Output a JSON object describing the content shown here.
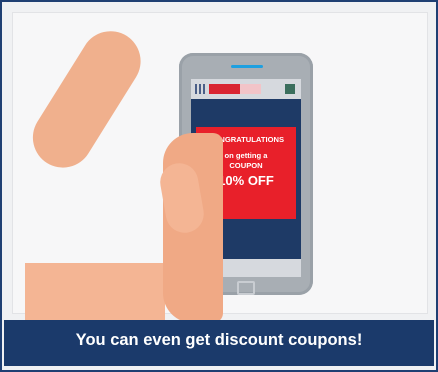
{
  "coupon": {
    "line1": "CONGRATULATIONS",
    "line2": "on getting a",
    "line3": "COUPON",
    "line4": "10% OFF"
  },
  "caption": "You can even get discount coupons!",
  "colors": {
    "frame_border": "#1f3f73",
    "caption_bg": "#1b3a6b",
    "coupon_bg": "#e8202a",
    "screen_bg": "#1e3a66",
    "skin": "#f0b08d"
  },
  "icons": {
    "phone": "smartphone-icon",
    "hand": "hand-illustration"
  }
}
